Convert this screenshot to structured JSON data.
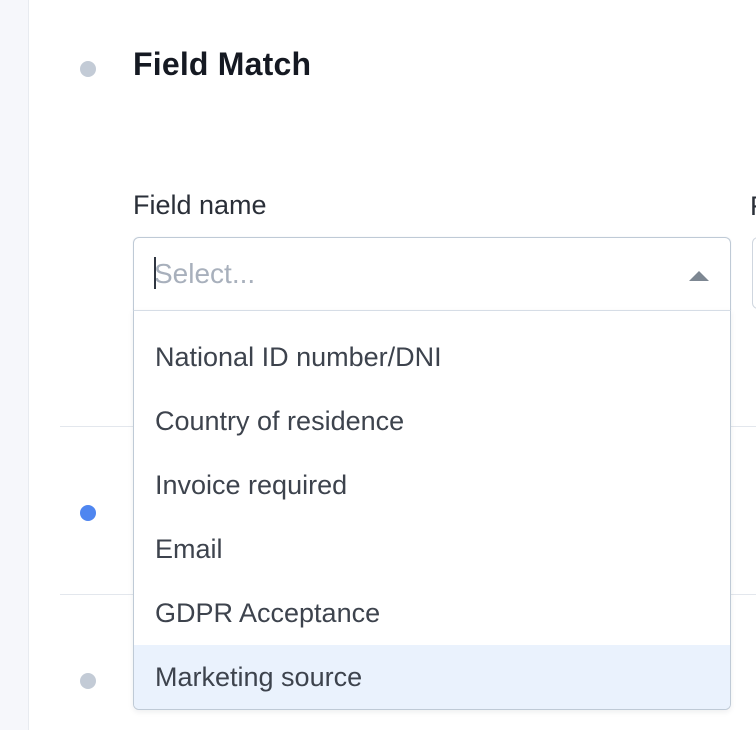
{
  "steps": {
    "field_match": {
      "title": "Field Match"
    }
  },
  "field": {
    "label": "Field name",
    "next_label": "F",
    "select": {
      "placeholder": "Select...",
      "value": "",
      "expanded": true,
      "chevron_icon": "chevron-up-icon"
    },
    "options": [
      {
        "label": "National ID number/DNI"
      },
      {
        "label": "Country of residence"
      },
      {
        "label": "Invoice required"
      },
      {
        "label": "Email"
      },
      {
        "label": "GDPR Acceptance"
      },
      {
        "label": "Marketing source",
        "highlighted": true
      }
    ]
  },
  "colors": {
    "accent_dot": "#4f86f0",
    "inactive_dot": "#c3cbd6",
    "highlight": "#eaf2fd",
    "border": "#bfcad6"
  }
}
